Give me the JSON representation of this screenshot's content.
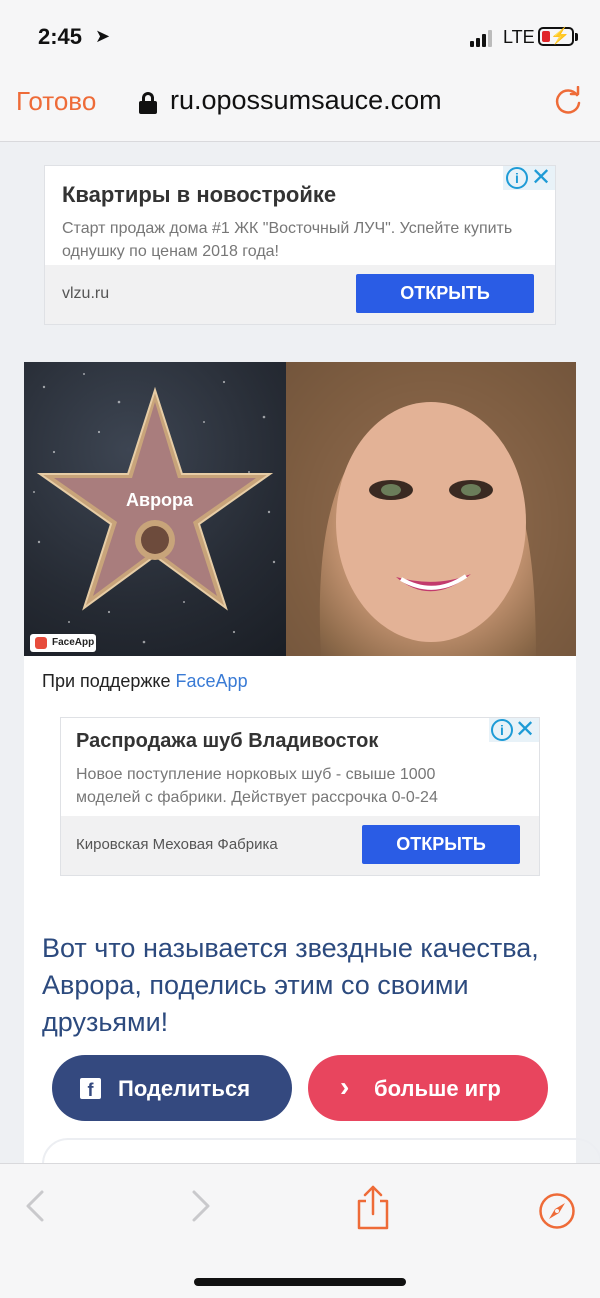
{
  "status_bar": {
    "time": "2:45",
    "network": "LTE"
  },
  "browser": {
    "done_label": "Готово",
    "url": "ru.opossumsauce.com",
    "accent_color": "#ee6b38"
  },
  "ads": [
    {
      "title": "Квартиры в новостройке",
      "description": "Старт продаж дома #1 ЖК \"Восточный ЛУЧ\". Успейте купить однушку по ценам 2018 года!",
      "domain": "vlzu.ru",
      "button_label": "ОТКРЫТЬ"
    },
    {
      "title": "Распродажа шуб Владивосток",
      "description": "Новое поступление норковых шуб - свыше 1000 моделей с фабрики. Действует рассрочка 0-0-24",
      "domain": "Кировская Меховая Фабрика",
      "button_label": "ОТКРЫТЬ"
    }
  ],
  "result": {
    "star_name": "Аврора",
    "badge_text": "FaceApp",
    "powered_prefix": "При поддержке ",
    "powered_link": "FaceApp",
    "headline": "Вот что называется звездные качества, Аврора, поделись этим со своими друзьями!",
    "share_label": "Поделиться",
    "more_games_label": "больше игр"
  }
}
